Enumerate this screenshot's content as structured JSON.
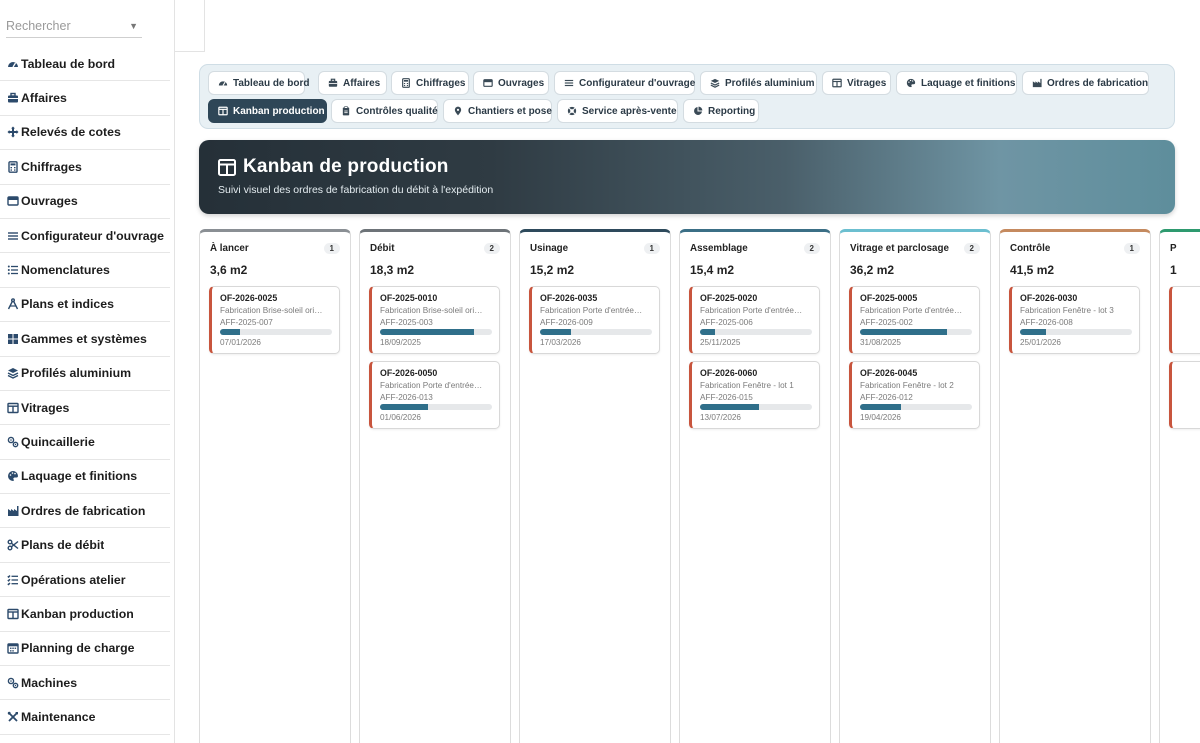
{
  "sidebar": {
    "search_placeholder": "Rechercher",
    "items": [
      {
        "label": "Tableau de bord",
        "icon": "gauge-icon"
      },
      {
        "label": "Affaires",
        "icon": "briefcase-icon"
      },
      {
        "label": "Relevés de cotes",
        "icon": "arrows-icon"
      },
      {
        "label": "Chiffrages",
        "icon": "calculator-icon"
      },
      {
        "label": "Ouvrages",
        "icon": "window-icon"
      },
      {
        "label": "Configurateur d'ouvrage",
        "icon": "sliders-icon"
      },
      {
        "label": "Nomenclatures",
        "icon": "list-icon"
      },
      {
        "label": "Plans et indices",
        "icon": "drafting-icon"
      },
      {
        "label": "Gammes et systèmes",
        "icon": "grid-icon"
      },
      {
        "label": "Profilés aluminium",
        "icon": "layers-icon"
      },
      {
        "label": "Vitrages",
        "icon": "glazing-icon"
      },
      {
        "label": "Quincaillerie",
        "icon": "gears-icon"
      },
      {
        "label": "Laquage et finitions",
        "icon": "palette-icon"
      },
      {
        "label": "Ordres de fabrication",
        "icon": "factory-icon"
      },
      {
        "label": "Plans de débit",
        "icon": "scissors-icon"
      },
      {
        "label": "Opérations atelier",
        "icon": "checklist-icon"
      },
      {
        "label": "Kanban production",
        "icon": "kanban-icon"
      },
      {
        "label": "Planning de charge",
        "icon": "calendar-icon"
      },
      {
        "label": "Machines",
        "icon": "gears-icon"
      },
      {
        "label": "Maintenance",
        "icon": "tools-icon"
      }
    ]
  },
  "nav": {
    "row1": [
      {
        "label": "Tableau de bord",
        "icon": "gauge-icon"
      },
      {
        "label": "Affaires",
        "icon": "briefcase-icon"
      },
      {
        "label": "Chiffrages",
        "icon": "calculator-icon"
      },
      {
        "label": "Ouvrages",
        "icon": "window-icon"
      },
      {
        "label": "Configurateur d'ouvrage",
        "icon": "sliders-icon"
      },
      {
        "label": "Profilés aluminium",
        "icon": "layers-icon"
      },
      {
        "label": "Vitrages",
        "icon": "glazing-icon"
      },
      {
        "label": "Laquage et finitions",
        "icon": "palette-icon"
      },
      {
        "label": "Ordres de fabrication",
        "icon": "factory-icon"
      }
    ],
    "row2": [
      {
        "label": "Kanban production",
        "icon": "kanban-icon",
        "active": true
      },
      {
        "label": "Contrôles qualité",
        "icon": "clipboard-icon"
      },
      {
        "label": "Chantiers et pose",
        "icon": "map-pin-icon"
      },
      {
        "label": "Service après-vente",
        "icon": "lifebuoy-icon"
      },
      {
        "label": "Reporting",
        "icon": "pie-chart-icon"
      }
    ]
  },
  "banner": {
    "title": "Kanban de production",
    "subtitle": "Suivi visuel des ordres de fabrication du débit à l'expédition",
    "icon": "kanban-icon"
  },
  "colors": {
    "active_chip": "#2e4657",
    "card_accent": "#c8553d",
    "progress": "#2f6f8a"
  },
  "columns": [
    {
      "title": "À lancer",
      "count": "1",
      "area": "3,6 m2",
      "accent": "#8a8f94",
      "cards": [
        {
          "ref": "OF-2026-0025",
          "desc": "Fabrication Brise-soleil orientable",
          "aff": "AFF-2025-007",
          "progress": 0.18,
          "date": "07/01/2026"
        }
      ]
    },
    {
      "title": "Débit",
      "count": "2",
      "area": "18,3 m2",
      "accent": "#6d7378",
      "cards": [
        {
          "ref": "OF-2025-0010",
          "desc": "Fabrication Brise-soleil orientable",
          "aff": "AFF-2025-003",
          "progress": 0.84,
          "date": "18/09/2025"
        },
        {
          "ref": "OF-2026-0050",
          "desc": "Fabrication Porte d'entrée aluminium",
          "aff": "AFF-2026-013",
          "progress": 0.43,
          "date": "01/06/2026"
        }
      ]
    },
    {
      "title": "Usinage",
      "count": "1",
      "area": "15,2 m2",
      "accent": "#2e4a5c",
      "cards": [
        {
          "ref": "OF-2026-0035",
          "desc": "Fabrication Porte d'entrée aluminium",
          "aff": "AFF-2026-009",
          "progress": 0.28,
          "date": "17/03/2026"
        }
      ]
    },
    {
      "title": "Assemblage",
      "count": "2",
      "area": "15,4 m2",
      "accent": "#3b6f86",
      "cards": [
        {
          "ref": "OF-2025-0020",
          "desc": "Fabrication Porte d'entrée aluminium",
          "aff": "AFF-2025-006",
          "progress": 0.13,
          "date": "25/11/2025"
        },
        {
          "ref": "OF-2026-0060",
          "desc": "Fabrication Fenêtre - lot 1",
          "aff": "AFF-2026-015",
          "progress": 0.53,
          "date": "13/07/2026"
        }
      ]
    },
    {
      "title": "Vitrage et parclosage",
      "count": "2",
      "area": "36,2 m2",
      "accent": "#6cbfd0",
      "cards": [
        {
          "ref": "OF-2025-0005",
          "desc": "Fabrication Porte d'entrée aluminium",
          "aff": "AFF-2025-002",
          "progress": 0.78,
          "date": "31/08/2025"
        },
        {
          "ref": "OF-2026-0045",
          "desc": "Fabrication Fenêtre - lot 2",
          "aff": "AFF-2026-012",
          "progress": 0.37,
          "date": "19/04/2026"
        }
      ]
    },
    {
      "title": "Contrôle",
      "count": "1",
      "area": "41,5 m2",
      "accent": "#c58a5f",
      "cards": [
        {
          "ref": "OF-2026-0030",
          "desc": "Fabrication Fenêtre - lot 3",
          "aff": "AFF-2026-008",
          "progress": 0.23,
          "date": "25/01/2026"
        }
      ]
    },
    {
      "title": "P",
      "count": "",
      "area": "1",
      "accent": "#2e9a6f",
      "cards": [
        {
          "ref": "",
          "desc": "",
          "aff": "",
          "progress": 0,
          "date": ""
        },
        {
          "ref": "",
          "desc": "",
          "aff": "",
          "progress": 0,
          "date": ""
        }
      ]
    }
  ]
}
